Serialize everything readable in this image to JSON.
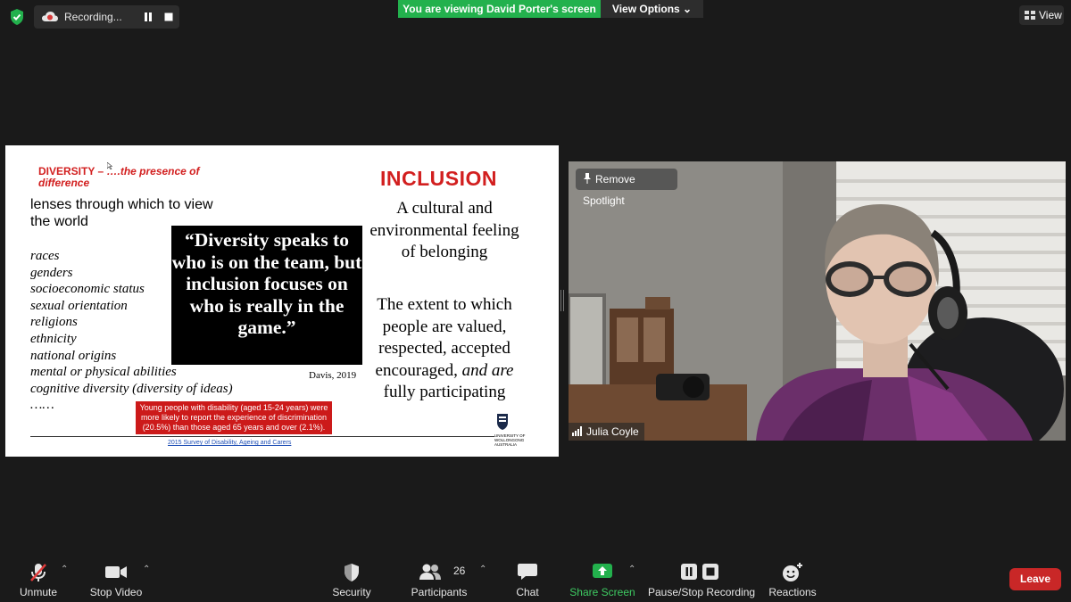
{
  "topbar": {
    "recording_label": "Recording...",
    "viewing_banner": "You are viewing David Porter's screen",
    "view_options_label": "View Options ⌄",
    "view_label": "View"
  },
  "slide": {
    "diversity_title_a": "DIVERSITY – ",
    "diversity_title_b": "….the presence of difference",
    "lenses": "lenses through which to view the world",
    "list_items": [
      "races",
      "genders",
      "socioeconomic status",
      "sexual orientation",
      "religions",
      "ethnicity",
      "national origins",
      "mental or physical abilities",
      "cognitive diversity (diversity of ideas)",
      "……"
    ],
    "quote": "“Diversity speaks to who is on the team, but inclusion focuses on who is really in the game.”",
    "quote_attribution": "Davis, 2019",
    "stat_box": "Young people with disability (aged 15-24 years) were more likely to report the experience of discrimination (20.5%) than those aged 65 years and over (2.1%).",
    "survey_link": "2015 Survey of Disability, Ageing and Carers",
    "inclusion_title": "INCLUSION",
    "inclusion_text1": "A cultural and environmental feeling of belonging",
    "inclusion_text2_a": "The extent to which people are valued, respected, accepted encouraged, ",
    "inclusion_text2_b": "and are",
    "inclusion_text2_c": " fully participating",
    "logo_text": "UNIVERSITY OF WOLLONGONG AUSTRALIA"
  },
  "video": {
    "remove_spotlight": "Remove Spotlight",
    "participant_name": "Julia Coyle"
  },
  "toolbar": {
    "unmute": "Unmute",
    "stop_video": "Stop Video",
    "security": "Security",
    "participants": "Participants",
    "participant_count": "26",
    "chat": "Chat",
    "share_screen": "Share Screen",
    "pause_stop_recording": "Pause/Stop Recording",
    "reactions": "Reactions",
    "leave": "Leave"
  },
  "colors": {
    "banner_green": "#23b14d",
    "leave_red": "#c92727",
    "slide_red": "#d21f1f",
    "share_green": "#3ecb62"
  }
}
